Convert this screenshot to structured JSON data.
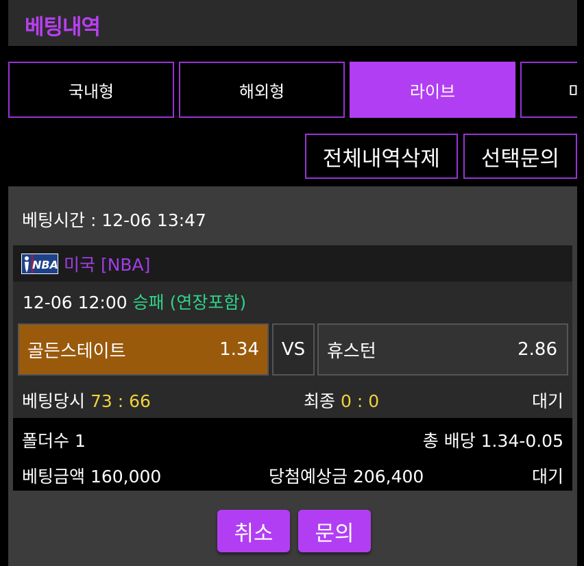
{
  "header": {
    "title": "베팅내역"
  },
  "tabs": [
    {
      "label": "국내형",
      "active": false
    },
    {
      "label": "해외형",
      "active": false
    },
    {
      "label": "라이브",
      "active": true
    },
    {
      "label": "미",
      "active": false
    }
  ],
  "actions": {
    "delete_all": "전체내역삭제",
    "inquire_selected": "선택문의"
  },
  "bet": {
    "time_label": "베팅시간 : 12-06 13:47",
    "league_logo_text": "NBA",
    "league": "미국 [NBA]",
    "match_time": "12-06 12:00",
    "market": "승패 (연장포함)",
    "home_team": "골든스테이트",
    "home_odds": "1.34",
    "vs": "VS",
    "away_team": "휴스턴",
    "away_odds": "2.86",
    "score_at_bet_label": "베팅당시",
    "score_at_bet": "73 : 66",
    "final_label": "최종",
    "final_score": "0 : 0",
    "status": "대기",
    "folders": "폴더수 1",
    "total_odds": "총 배당 1.34-0.05",
    "amount": "베팅금액 160,000",
    "expected": "당첨예상금 206,400",
    "status2": "대기"
  },
  "footer": {
    "cancel": "취소",
    "inquire": "문의"
  },
  "colors": {
    "accent": "#b23ef3",
    "market": "#2fd38a",
    "score": "#f0d23c",
    "selected": "#9a5a0c"
  }
}
